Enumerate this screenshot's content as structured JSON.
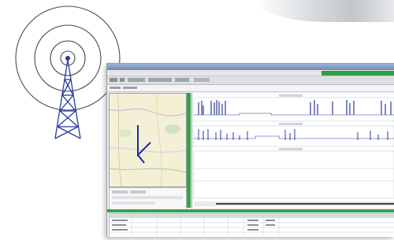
{
  "decor": {
    "tower_icon": "radio-tower-icon",
    "accent_green": "#37a24a",
    "trace_blue": "#2a3b9c"
  },
  "app": {
    "title_bar_text": "",
    "status_text": ""
  },
  "map": {
    "route_color": "#1a2aa0"
  },
  "plots": {
    "panel_count": 3
  },
  "table": {
    "rows": 3
  }
}
